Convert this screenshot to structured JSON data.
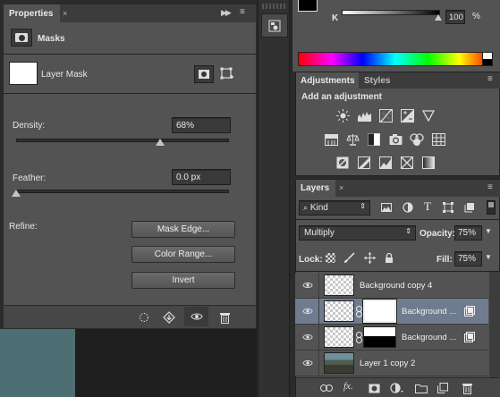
{
  "properties": {
    "tab_label": "Properties",
    "section_title": "Masks",
    "mask_label": "Layer Mask",
    "density_label": "Density:",
    "density_value": "68%",
    "density_level": 0.68,
    "feather_label": "Feather:",
    "feather_value": "0.0 px",
    "feather_level": 0.0,
    "refine_label": "Refine:",
    "mask_edge_button": "Mask Edge...",
    "color_range_button": "Color Range...",
    "invert_button": "Invert"
  },
  "color_panel": {
    "channel_label": "K",
    "value": "100",
    "unit": "%"
  },
  "adjustments": {
    "tab_label": "Adjustments",
    "styles_tab_label": "Styles",
    "heading": "Add an adjustment"
  },
  "layers": {
    "tab_label": "Layers",
    "filter_kind": "Kind",
    "blend_mode": "Multiply",
    "opacity_label": "Opacity:",
    "opacity_value": "75%",
    "lock_label": "Lock:",
    "fill_label": "Fill:",
    "fill_value": "75%",
    "items": [
      {
        "name": "Background copy 4"
      },
      {
        "name": "Background ..."
      },
      {
        "name": "Background ..."
      },
      {
        "name": "Layer 1 copy 2"
      }
    ]
  },
  "colors": {
    "panel_bg": "#535353",
    "selected_row": "#6f7c8f",
    "dark_bg": "#2b2b2b"
  }
}
